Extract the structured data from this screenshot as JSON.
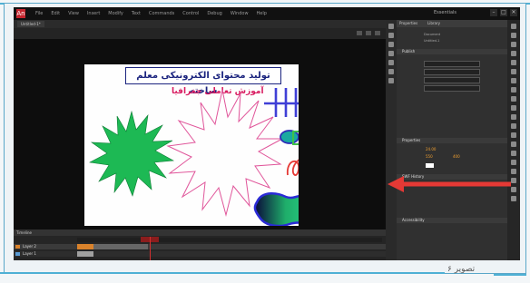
{
  "app": {
    "logo": "An",
    "menu": [
      "File",
      "Edit",
      "View",
      "Insert",
      "Modify",
      "Text",
      "Commands",
      "Control",
      "Debug",
      "Window",
      "Help"
    ],
    "workspace": "Essentials",
    "window_buttons": [
      "–",
      "□",
      "✕"
    ]
  },
  "document": {
    "tab": "Untitled-1*",
    "stage": {
      "title": "تولید محتوای الکترونیکی معلم ساخته",
      "subtitle": "آموزش تعاملی جغرافیا"
    }
  },
  "timeline": {
    "tab": "Timeline",
    "layers": [
      {
        "name": "Layer 2",
        "color": "#d9822b"
      },
      {
        "name": "Layer 1",
        "color": "#5a9bd4"
      }
    ]
  },
  "properties": {
    "tabs": [
      "Properties",
      "Library"
    ],
    "doc_label": "Document",
    "doc_name": "Untitled-1",
    "sections": [
      "Publish",
      "Properties",
      "SWF History",
      "Accessibility"
    ],
    "fps_value": "24.00",
    "size_w": "550",
    "size_h": "400"
  },
  "colors": {
    "accent_arrow": "#e53935",
    "star_green": "#1db954",
    "stage_bg": "#fefefe",
    "frame_border": "#4fb0d4"
  },
  "caption": "تصویر ۶"
}
